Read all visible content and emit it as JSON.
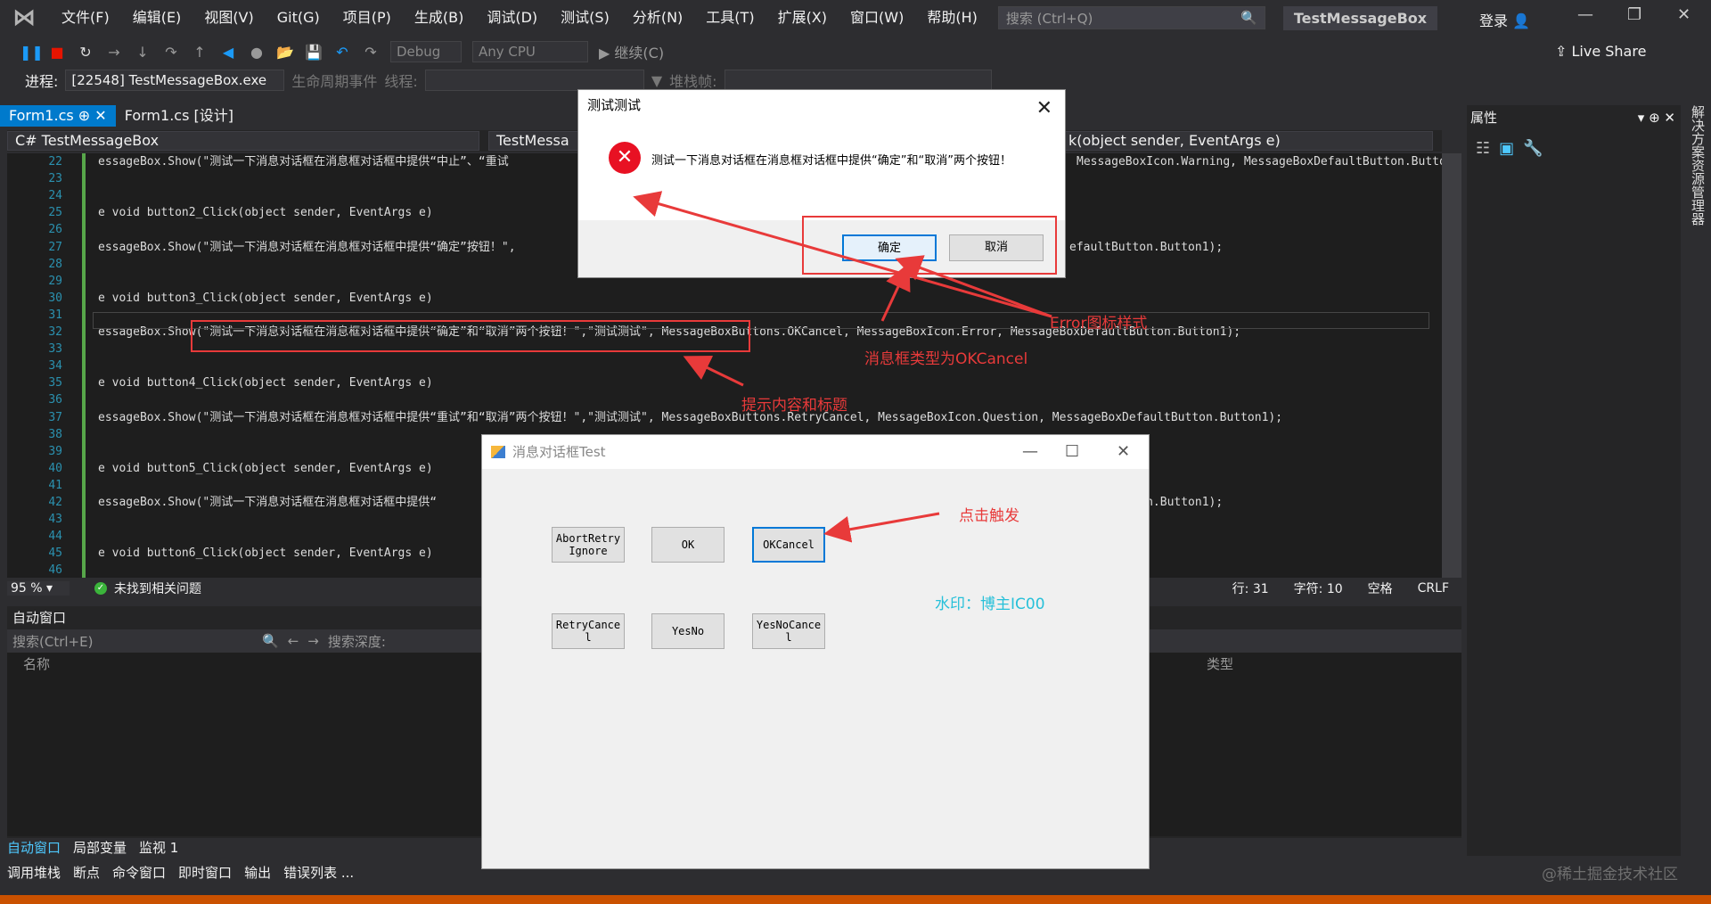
{
  "menu": [
    "文件(F)",
    "编辑(E)",
    "视图(V)",
    "Git(G)",
    "项目(P)",
    "生成(B)",
    "调试(D)",
    "测试(S)",
    "分析(N)",
    "工具(T)",
    "扩展(X)",
    "窗口(W)",
    "帮助(H)"
  ],
  "search": {
    "placeholder": "搜索 (Ctrl+Q)"
  },
  "window_title": "TestMessageBox",
  "login": "登录",
  "live_share": "Live Share",
  "toolbar": {
    "config": "Debug",
    "platform": "Any CPU",
    "continue": "继续(C)"
  },
  "process_bar": {
    "label": "进程:",
    "process": "[22548] TestMessageBox.exe",
    "lifecycle": "生命周期事件",
    "thread": "线程:",
    "stack": "堆栈帧:"
  },
  "tabs": [
    "Form1.cs",
    "Form1.cs [设计]"
  ],
  "nav": {
    "project": "TestMessageBox",
    "class": "TestMessa",
    "member": "k(object sender, EventArgs e)"
  },
  "code_lines": [
    {
      "n": "22",
      "t": "essageBox.Show(\"测试一下消息对话框在消息框对话框中提供“中止”、“重试",
      "tail": "MessageBoxIcon.Warning, MessageBoxDefaultButton.Butto"
    },
    {
      "n": "23",
      "t": "",
      "tail": ""
    },
    {
      "n": "24",
      "t": "",
      "tail": ""
    },
    {
      "n": "25",
      "t": "e void button2_Click(object sender, EventArgs e)",
      "tail": ""
    },
    {
      "n": "26",
      "t": "",
      "tail": ""
    },
    {
      "n": "27",
      "t": "essageBox.Show(\"测试一下消息对话框在消息框对话框中提供“确定”按钮！\",",
      "tail": "efaultButton.Button1);"
    },
    {
      "n": "28",
      "t": "",
      "tail": ""
    },
    {
      "n": "29",
      "t": "",
      "tail": ""
    },
    {
      "n": "30",
      "t": "e void button3_Click(object sender, EventArgs e)",
      "tail": ""
    },
    {
      "n": "31",
      "t": "",
      "tail": ""
    },
    {
      "n": "32",
      "t": "essageBox.Show(\"测试一下消息对话框在消息框对话框中提供“确定”和“取消”两个按钮！\",\"测试测试\", MessageBoxButtons.OKCancel, MessageBoxIcon.Error, MessageBoxDefaultButton.Button1);",
      "tail": ""
    },
    {
      "n": "33",
      "t": "",
      "tail": ""
    },
    {
      "n": "34",
      "t": "",
      "tail": ""
    },
    {
      "n": "35",
      "t": "e void button4_Click(object sender, EventArgs e)",
      "tail": ""
    },
    {
      "n": "36",
      "t": "",
      "tail": ""
    },
    {
      "n": "37",
      "t": "essageBox.Show(\"测试一下消息对话框在消息框对话框中提供“重试”和“取消”两个按钮！\",\"测试测试\", MessageBoxButtons.RetryCancel, MessageBoxIcon.Question, MessageBoxDefaultButton.Button1);",
      "tail": ""
    },
    {
      "n": "38",
      "t": "",
      "tail": ""
    },
    {
      "n": "39",
      "t": "",
      "tail": ""
    },
    {
      "n": "40",
      "t": "e void button5_Click(object sender, EventArgs e)",
      "tail": ""
    },
    {
      "n": "41",
      "t": "",
      "tail": ""
    },
    {
      "n": "42",
      "t": "essageBox.Show(\"测试一下消息对话框在消息框对话框中提供“",
      "tail": "efaultButton.Button1);"
    },
    {
      "n": "43",
      "t": "",
      "tail": ""
    },
    {
      "n": "44",
      "t": "",
      "tail": ""
    },
    {
      "n": "45",
      "t": "e void button6_Click(object sender, EventArgs e)",
      "tail": ""
    },
    {
      "n": "46",
      "t": "",
      "tail": ""
    }
  ],
  "editor_status": {
    "zoom": "95 %",
    "issues": "未找到相关问题",
    "line": "行: 31",
    "char": "字符: 10",
    "space": "空格",
    "eol": "CRLF"
  },
  "auto_window": {
    "title": "自动窗口",
    "search": "搜索(Ctrl+E)",
    "depth": "搜索深度:",
    "col_name": "名称",
    "col_type": "类型"
  },
  "bottom_tabs": [
    "自动窗口",
    "局部变量",
    "监视 1"
  ],
  "bottom_row": [
    "调用堆栈",
    "断点",
    "命令窗口",
    "即时窗口",
    "输出",
    "错误列表 ..."
  ],
  "properties": {
    "title": "属性"
  },
  "side_panel": "解决方案资源管理器",
  "msgbox": {
    "title": "测试测试",
    "text": "测试一下消息对话框在消息框对话框中提供“确定”和“取消”两个按钮！",
    "ok": "确定",
    "cancel": "取消"
  },
  "form": {
    "title": "消息对话框Test",
    "buttons": [
      "AbortRetryIgnore",
      "OK",
      "OKCancel",
      "RetryCancel",
      "YesNo",
      "YesNoCancel"
    ],
    "watermark": "水印：博主IC00"
  },
  "annotations": {
    "error_icon": "Error图标样式",
    "okcancel": "消息框类型为OKCancel",
    "content": "提示内容和标题",
    "click": "点击触发"
  },
  "watermark_site": "@稀土掘金技术社区",
  "colors": {
    "accent": "#007acc",
    "annotation": "#e83a3a",
    "status_bar": "#ca5100"
  }
}
